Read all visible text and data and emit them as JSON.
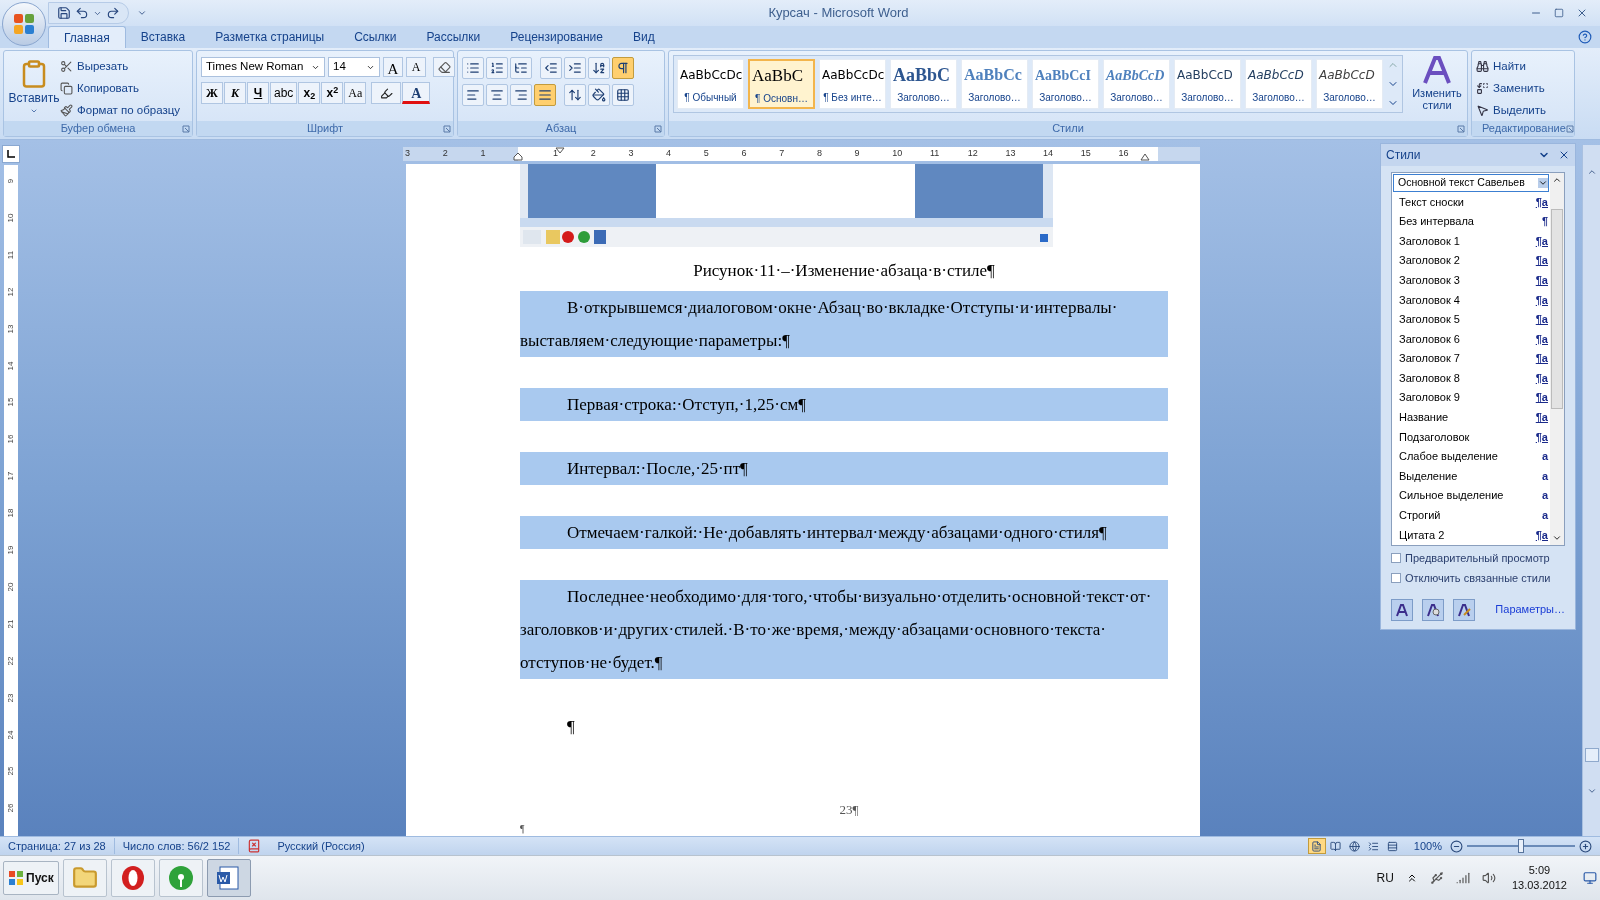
{
  "window": {
    "title": "Курсач - Microsoft Word"
  },
  "ribbon_tabs": [
    {
      "label": "Главная",
      "selected": true
    },
    {
      "label": "Вставка",
      "selected": false
    },
    {
      "label": "Разметка страницы",
      "selected": false
    },
    {
      "label": "Ссылки",
      "selected": false
    },
    {
      "label": "Рассылки",
      "selected": false
    },
    {
      "label": "Рецензирование",
      "selected": false
    },
    {
      "label": "Вид",
      "selected": false
    }
  ],
  "clipboard_group": {
    "title": "Буфер обмена",
    "paste": "Вставить",
    "items": [
      {
        "label": "Вырезать",
        "kind": "cut"
      },
      {
        "label": "Копировать",
        "kind": "copy"
      },
      {
        "label": "Формат по образцу",
        "kind": "format"
      }
    ]
  },
  "font_group": {
    "title": "Шрифт",
    "font": "Times New Roman",
    "size": "14",
    "size_buttons": [
      "A",
      "A"
    ],
    "buttons": [
      {
        "label": "Ж",
        "kind": "bold"
      },
      {
        "label": "К",
        "kind": "italic"
      },
      {
        "label": "Ч",
        "kind": "underline"
      },
      {
        "label": "abc",
        "kind": "strike"
      },
      {
        "label": "x$_{2}$",
        "kind": "sub"
      },
      {
        "label": "x$^{2}$",
        "kind": "sup"
      },
      {
        "label": "Aa",
        "kind": "case"
      }
    ],
    "font_color": "A"
  },
  "paragraph_group": {
    "title": "Абзац",
    "show_marks": {
      "selected": true
    },
    "alignments": [
      {
        "kind": "left",
        "selected": false
      },
      {
        "kind": "center",
        "selected": false
      },
      {
        "kind": "right",
        "selected": false
      },
      {
        "kind": "justify",
        "selected": true
      }
    ]
  },
  "styles_group": {
    "title": "Стили",
    "change_styles": "Изменить стили",
    "gallery": [
      {
        "sample": "AaBbCcDc",
        "label": "¶ Обычный",
        "kind": "normal",
        "selected": false
      },
      {
        "sample": "AaBbC",
        "label": "¶ Основн…",
        "kind": "body",
        "selected": true
      },
      {
        "sample": "AaBbCcDc",
        "label": "¶ Без инте…",
        "kind": "normal",
        "selected": false
      },
      {
        "sample": "AaBbC",
        "label": "Заголово…",
        "kind": "heading1",
        "selected": false
      },
      {
        "sample": "AaBbCc",
        "label": "Заголово…",
        "kind": "heading2",
        "selected": false
      },
      {
        "sample": "AaBbCcI",
        "label": "Заголово…",
        "kind": "heading3",
        "selected": false
      },
      {
        "sample": "AaBbCcD",
        "label": "Заголово…",
        "kind": "heading4",
        "selected": false
      },
      {
        "sample": "AaBbCcD",
        "label": "Заголово…",
        "kind": "heading5",
        "selected": false
      },
      {
        "sample": "AaBbCcD",
        "label": "Заголово…",
        "kind": "heading6",
        "selected": false
      },
      {
        "sample": "AaBbCcD",
        "label": "Заголово…",
        "kind": "heading7",
        "selected": false
      }
    ]
  },
  "editing_group": {
    "title": "Редактирование",
    "items": [
      {
        "label": "Найти",
        "kind": "find"
      },
      {
        "label": "Заменить",
        "kind": "replace"
      },
      {
        "label": "Выделить",
        "kind": "select"
      }
    ]
  },
  "ruler": {
    "left_labels": [
      "3",
      "2",
      "1"
    ],
    "right_labels": [
      "1",
      "2",
      "3",
      "4",
      "5",
      "6",
      "7",
      "8",
      "9",
      "10",
      "11",
      "12",
      "13",
      "14",
      "15",
      "16"
    ],
    "vertical_labels": [
      "9",
      "10",
      "11",
      "12",
      "13",
      "14",
      "15",
      "16",
      "17",
      "18",
      "19",
      "20",
      "21",
      "22",
      "23",
      "24",
      "25",
      "26"
    ]
  },
  "document": {
    "paragraphs": [
      {
        "kind": "caption",
        "text": "Рисунок·11·–·Изменение·абзаца·в·стиле¶",
        "highlighted": false
      },
      {
        "kind": "body",
        "text": "В·открывшемся·диалоговом·окне·Абзац·во·вкладке·Отступы·и·интервалы·выставляем·следующие·параметры:¶",
        "highlighted": true
      },
      {
        "kind": "body",
        "text": "Первая·строка:·Отступ,·1,25·см¶",
        "highlighted": true
      },
      {
        "kind": "body",
        "text": "Интервал:·После,·25·пт¶",
        "highlighted": true
      },
      {
        "kind": "body",
        "text": "Отмечаем·галкой:·Не·добавлять·интервал·между·абзацами·одного·стиля¶",
        "highlighted": true
      },
      {
        "kind": "body",
        "text": "Последнее·необходимо·для·того,·чтобы·визуально·отделить·основной·текст·от·заголовков·и·других·стилей.·В·то·же·время,·между·абзацами·основного·текста·отступов·не·будет.¶",
        "highlighted": true
      },
      {
        "kind": "body",
        "text": "¶",
        "highlighted": false
      }
    ],
    "page_number": "23¶",
    "footer_mark": "¶"
  },
  "styles_pane": {
    "title": "Стили",
    "current": "Основной текст Савельев",
    "items": [
      {
        "name": "Текст сноски",
        "mark": "¶a",
        "kind": "linked"
      },
      {
        "name": "Без интервала",
        "mark": "¶",
        "kind": "paragraph"
      },
      {
        "name": "Заголовок 1",
        "mark": "¶a",
        "kind": "linked"
      },
      {
        "name": "Заголовок 2",
        "mark": "¶a",
        "kind": "linked"
      },
      {
        "name": "Заголовок 3",
        "mark": "¶a",
        "kind": "linked"
      },
      {
        "name": "Заголовок 4",
        "mark": "¶a",
        "kind": "linked"
      },
      {
        "name": "Заголовок 5",
        "mark": "¶a",
        "kind": "linked"
      },
      {
        "name": "Заголовок 6",
        "mark": "¶a",
        "kind": "linked"
      },
      {
        "name": "Заголовок 7",
        "mark": "¶a",
        "kind": "linked"
      },
      {
        "name": "Заголовок 8",
        "mark": "¶a",
        "kind": "linked"
      },
      {
        "name": "Заголовок 9",
        "mark": "¶a",
        "kind": "linked"
      },
      {
        "name": "Название",
        "mark": "¶a",
        "kind": "linked"
      },
      {
        "name": "Подзаголовок",
        "mark": "¶a",
        "kind": "linked"
      },
      {
        "name": "Слабое выделение",
        "mark": "a",
        "kind": "character"
      },
      {
        "name": "Выделение",
        "mark": "a",
        "kind": "character"
      },
      {
        "name": "Сильное выделение",
        "mark": "a",
        "kind": "character"
      },
      {
        "name": "Строгий",
        "mark": "a",
        "kind": "character"
      },
      {
        "name": "Цитата 2",
        "mark": "¶a",
        "kind": "linked"
      }
    ],
    "options": [
      {
        "label": "Предварительный просмотр",
        "checked": false
      },
      {
        "label": "Отключить связанные стили",
        "checked": false
      }
    ],
    "link": "Параметры…"
  },
  "status_bar": {
    "page": "Страница: 27 из 28",
    "words": "Число слов: 56/2 152",
    "language": "Русский (Россия)",
    "zoom": "100%",
    "zoom_slider": {
      "level": 0.5
    },
    "views": [
      {
        "kind": "print",
        "selected": true
      },
      {
        "kind": "read",
        "selected": false
      },
      {
        "kind": "web",
        "selected": false
      },
      {
        "kind": "outline",
        "selected": false
      },
      {
        "kind": "draft",
        "selected": false
      }
    ]
  },
  "taskbar": {
    "start": "Пуск",
    "apps": [
      {
        "kind": "folder",
        "selected": false
      },
      {
        "kind": "opera",
        "selected": false
      },
      {
        "kind": "radio",
        "selected": false
      },
      {
        "kind": "word",
        "selected": true
      }
    ],
    "language": "RU",
    "time": "5:09",
    "date": "13.03.2012"
  }
}
